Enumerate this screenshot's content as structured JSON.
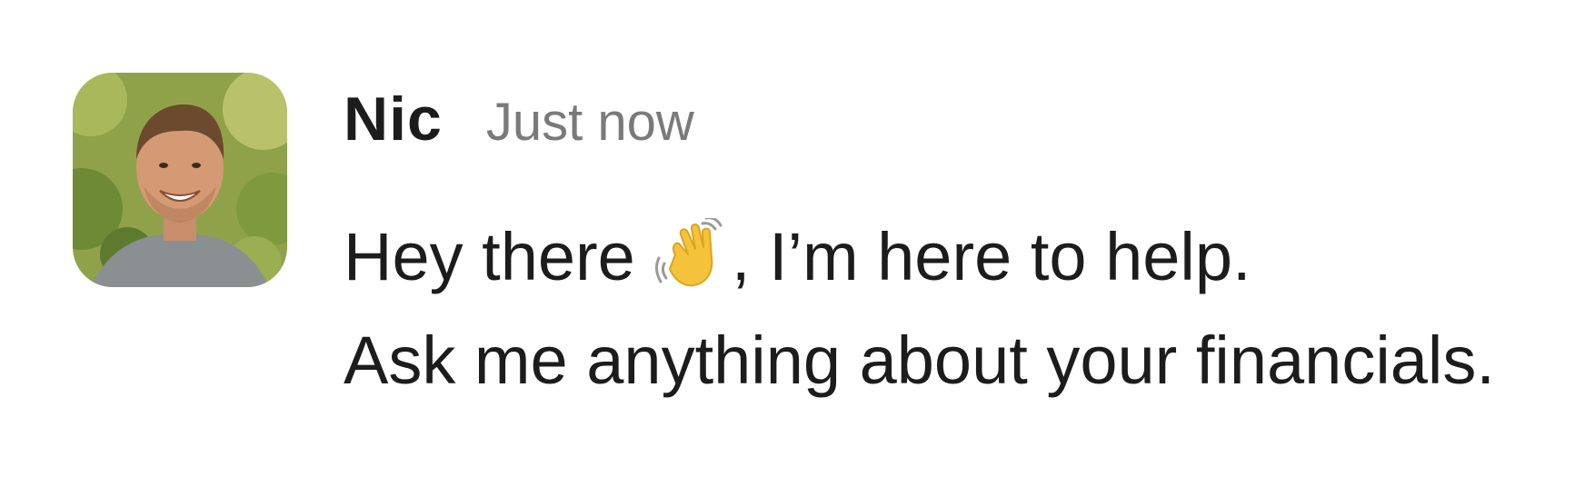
{
  "message": {
    "author": "Nic",
    "timestamp": "Just now",
    "line1_before": "Hey there",
    "line1_emoji": "waving-hand-emoji",
    "line1_after": ", I’m here to help.",
    "line2": "Ask me anything about your financials."
  },
  "avatar": {
    "icon": "avatar-photo"
  },
  "colors": {
    "author": "#1d1c1d",
    "timestamp": "#7a7a7a",
    "emoji": "#f5c33b"
  }
}
